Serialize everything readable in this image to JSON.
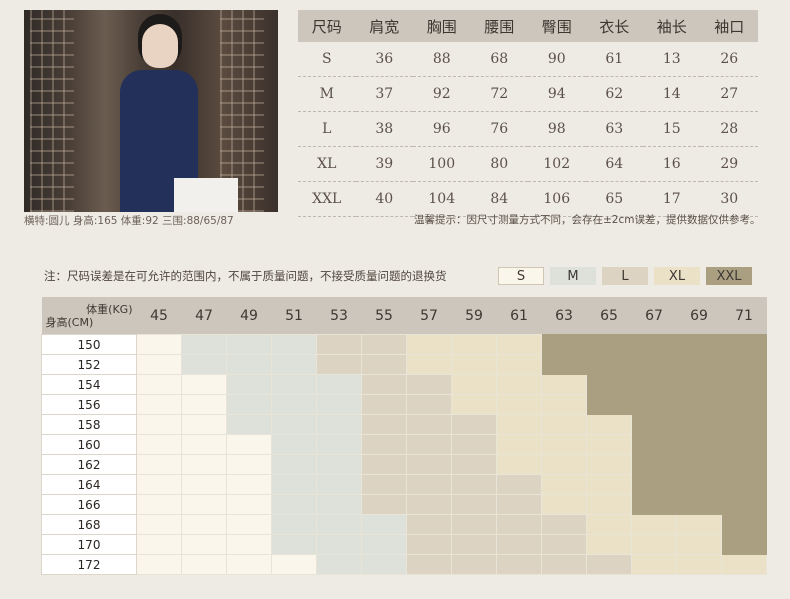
{
  "caption": "横特:圆儿 身高:165 体重:92 三围:88/65/87",
  "size_table": {
    "headers": [
      "尺码",
      "肩宽",
      "胸围",
      "腰围",
      "臀围",
      "衣长",
      "袖长",
      "袖口"
    ],
    "rows": [
      [
        "S",
        "36",
        "88",
        "68",
        "90",
        "61",
        "13",
        "26"
      ],
      [
        "M",
        "37",
        "92",
        "72",
        "94",
        "62",
        "14",
        "27"
      ],
      [
        "L",
        "38",
        "96",
        "76",
        "98",
        "63",
        "15",
        "28"
      ],
      [
        "XL",
        "39",
        "100",
        "80",
        "102",
        "64",
        "16",
        "29"
      ],
      [
        "XXL",
        "40",
        "104",
        "84",
        "106",
        "65",
        "17",
        "30"
      ]
    ]
  },
  "tip": "温馨提示：因尺寸测量方式不同，会存在±2cm误差，提供数据仅供参考。",
  "note": "注：尺码误差是在可允许的范围内，不属于质量问题，不接受质量问题的退换货",
  "legend": [
    {
      "label": "S",
      "color": "#faf6ec",
      "border": "#cfc6b4"
    },
    {
      "label": "M",
      "color": "#dde1da",
      "border": "#dde1da"
    },
    {
      "label": "L",
      "color": "#dcd3c3",
      "border": "#dcd3c3"
    },
    {
      "label": "XL",
      "color": "#eae1c7",
      "border": "#eae1c7"
    },
    {
      "label": "XXL",
      "color": "#aaa081",
      "border": "#aaa081"
    }
  ],
  "grid": {
    "weight_label": "体重(KG)",
    "height_label": "身高(CM)",
    "weights": [
      "45",
      "47",
      "49",
      "51",
      "53",
      "55",
      "57",
      "59",
      "61",
      "63",
      "65",
      "67",
      "69",
      "71"
    ],
    "heights": [
      "150",
      "152",
      "154",
      "156",
      "158",
      "160",
      "162",
      "164",
      "166",
      "168",
      "170",
      "172"
    ],
    "sizes": [
      [
        "S",
        "M",
        "M",
        "M",
        "L",
        "L",
        "XL",
        "XL",
        "XL",
        "XXL",
        "XXL",
        "XXL",
        "XXL",
        "XXL"
      ],
      [
        "S",
        "M",
        "M",
        "M",
        "L",
        "L",
        "XL",
        "XL",
        "XL",
        "XXL",
        "XXL",
        "XXL",
        "XXL",
        "XXL"
      ],
      [
        "S",
        "S",
        "M",
        "M",
        "M",
        "L",
        "L",
        "XL",
        "XL",
        "XL",
        "XXL",
        "XXL",
        "XXL",
        "XXL"
      ],
      [
        "S",
        "S",
        "M",
        "M",
        "M",
        "L",
        "L",
        "XL",
        "XL",
        "XL",
        "XXL",
        "XXL",
        "XXL",
        "XXL"
      ],
      [
        "S",
        "S",
        "M",
        "M",
        "M",
        "L",
        "L",
        "L",
        "XL",
        "XL",
        "XL",
        "XXL",
        "XXL",
        "XXL"
      ],
      [
        "S",
        "S",
        "S",
        "M",
        "M",
        "L",
        "L",
        "L",
        "XL",
        "XL",
        "XL",
        "XXL",
        "XXL",
        "XXL"
      ],
      [
        "S",
        "S",
        "S",
        "M",
        "M",
        "L",
        "L",
        "L",
        "XL",
        "XL",
        "XL",
        "XXL",
        "XXL",
        "XXL"
      ],
      [
        "S",
        "S",
        "S",
        "M",
        "M",
        "L",
        "L",
        "L",
        "L",
        "XL",
        "XL",
        "XXL",
        "XXL",
        "XXL"
      ],
      [
        "S",
        "S",
        "S",
        "M",
        "M",
        "L",
        "L",
        "L",
        "L",
        "XL",
        "XL",
        "XXL",
        "XXL",
        "XXL"
      ],
      [
        "S",
        "S",
        "S",
        "M",
        "M",
        "M",
        "L",
        "L",
        "L",
        "L",
        "XL",
        "XL",
        "XL",
        "XXL"
      ],
      [
        "S",
        "S",
        "S",
        "M",
        "M",
        "M",
        "L",
        "L",
        "L",
        "L",
        "XL",
        "XL",
        "XL",
        "XXL"
      ],
      [
        "S",
        "S",
        "S",
        "S",
        "M",
        "M",
        "L",
        "L",
        "L",
        "L",
        "L",
        "XL",
        "XL",
        "XL"
      ]
    ]
  }
}
